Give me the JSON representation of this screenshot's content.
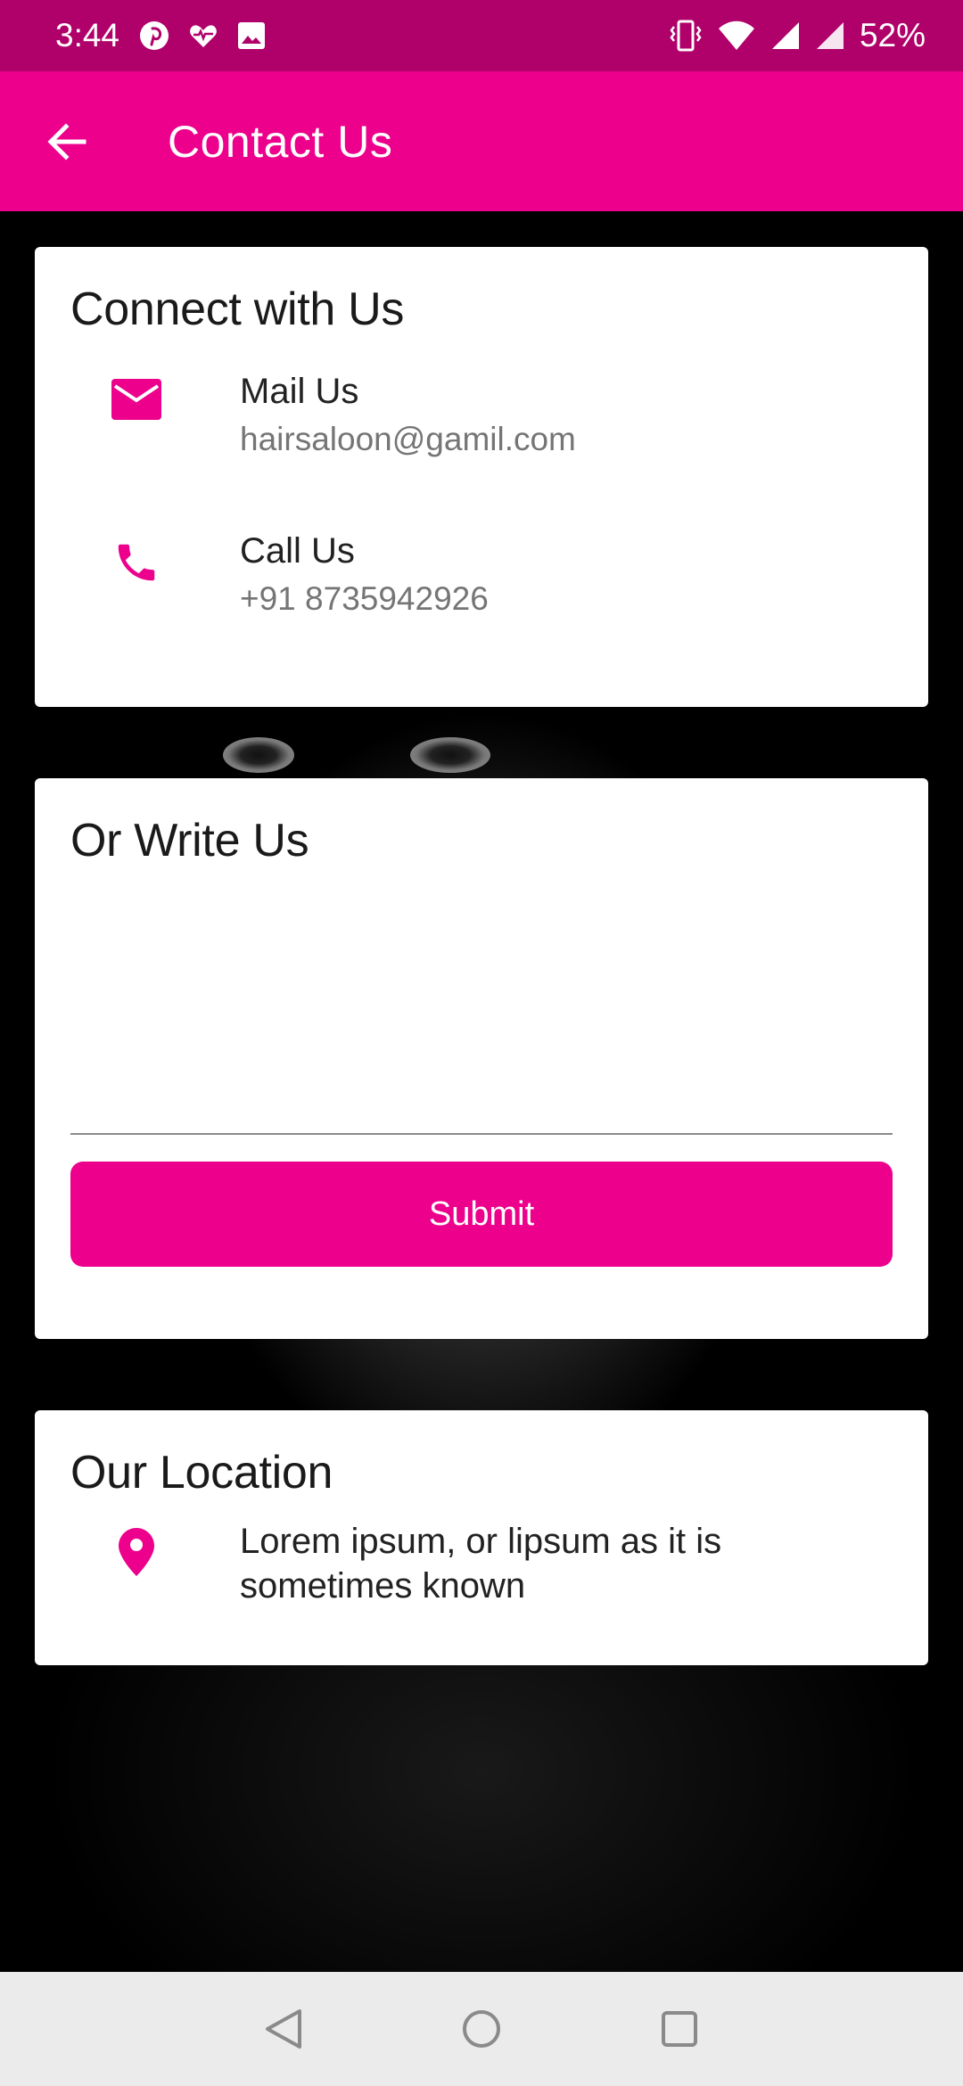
{
  "status_bar": {
    "time": "3:44",
    "battery": "52%",
    "left_icons": [
      "pinterest-icon",
      "heart-rate-icon",
      "image-icon"
    ],
    "right_icons": [
      "vibrate-icon",
      "wifi-icon",
      "signal-icon",
      "signal-icon"
    ]
  },
  "app_bar": {
    "title": "Contact Us",
    "back_icon": "arrow-back-icon"
  },
  "colors": {
    "primary": "#ec008c",
    "status_bar": "#b0006a",
    "card": "#ffffff",
    "secondary_text": "#757575"
  },
  "connect": {
    "heading": "Connect with Us",
    "mail": {
      "label": "Mail Us",
      "value": "hairsaloon@gamil.com",
      "icon": "mail-icon"
    },
    "call": {
      "label": "Call Us",
      "value": "+91 8735942926",
      "icon": "phone-icon"
    }
  },
  "write": {
    "heading": "Or Write Us",
    "message_value": "",
    "submit_label": "Submit"
  },
  "location": {
    "heading": "Our Location",
    "text": "Lorem ipsum, or lipsum as it is sometimes known",
    "icon": "location-pin-icon"
  },
  "nav_bar": {
    "buttons": [
      "back-triangle-icon",
      "home-circle-icon",
      "recents-square-icon"
    ]
  }
}
